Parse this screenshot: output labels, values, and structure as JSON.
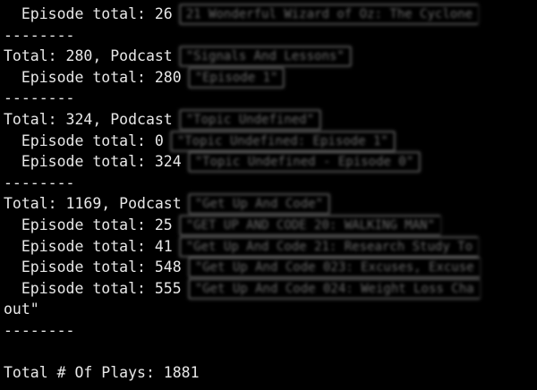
{
  "lines": {
    "l0": {
      "text": "  Episode total: 26",
      "hidden": "21 Wonderful Wizard of Oz: The Cyclone"
    },
    "l1": {
      "text": "--------"
    },
    "l2": {
      "text": "Total: 280, Podcast",
      "hidden": "\"Signals And Lessons\""
    },
    "l3": {
      "text": "  Episode total: 280",
      "hidden": "\"Episode 1\""
    },
    "l4": {
      "text": "--------"
    },
    "l5": {
      "text": "Total: 324, Podcast",
      "hidden": "\"Topic Undefined\""
    },
    "l6": {
      "text": "  Episode total: 0",
      "hidden": "\"Topic Undefined: Episode 1\""
    },
    "l7": {
      "text": "  Episode total: 324",
      "hidden": "\"Topic Undefined - Episode 0\""
    },
    "l8": {
      "text": "--------"
    },
    "l9": {
      "text": "Total: 1169, Podcast",
      "hidden": "\"Get Up And Code\""
    },
    "l10": {
      "text": "  Episode total: 25",
      "hidden": "\"GET UP AND CODE 20: WALKING MAN\""
    },
    "l11": {
      "text": "  Episode total: 41",
      "hidden": "\"Get Up And Code 21: Research Study To"
    },
    "l12": {
      "text": "  Episode total: 548",
      "hidden": "\"Get Up And Code 023: Excuses, Excuse"
    },
    "l13": {
      "text": "  Episode total: 555",
      "hidden": "\"Get Up And Code 024: Weight Loss Cha"
    },
    "l14": {
      "text": "out\""
    },
    "l15": {
      "text": "--------"
    },
    "l16": {
      "text": ""
    },
    "l17": {
      "text": "Total # Of Plays: 1881"
    }
  }
}
